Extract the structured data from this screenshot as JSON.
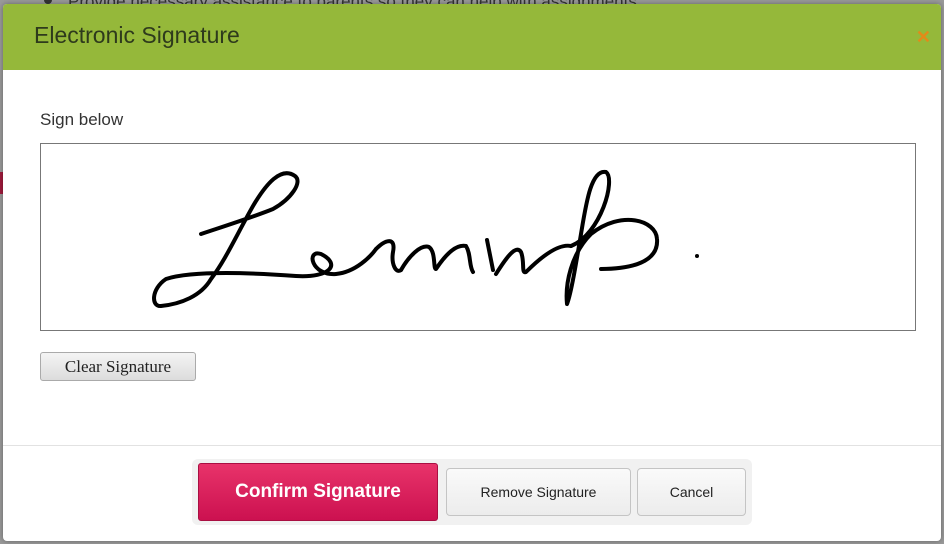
{
  "background": {
    "text": "Provide necessary assistance to parents so they can help with assignments"
  },
  "dialog": {
    "title": "Electronic Signature",
    "close_icon": "close-x-icon",
    "sign_label": "Sign below",
    "signature_text": "Lenin",
    "clear_label": "Clear Signature",
    "confirm_label": "Confirm Signature",
    "remove_label": "Remove Signature",
    "cancel_label": "Cancel"
  },
  "colors": {
    "header": "#95b83a",
    "close": "#e38a19",
    "confirm": "#d81b5a"
  }
}
